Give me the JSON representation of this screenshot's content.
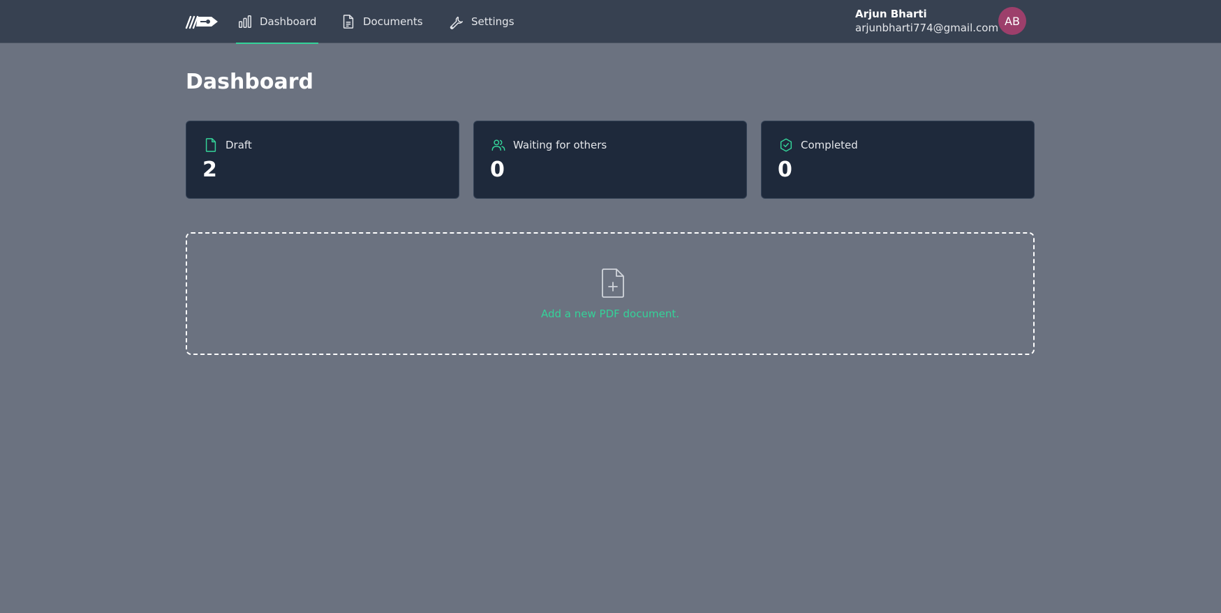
{
  "nav": {
    "items": [
      {
        "label": "Dashboard",
        "icon": "bar-chart-icon",
        "active": true
      },
      {
        "label": "Documents",
        "icon": "document-icon",
        "active": false
      },
      {
        "label": "Settings",
        "icon": "wrench-icon",
        "active": false
      }
    ]
  },
  "user": {
    "name": "Arjun Bharti",
    "email": "arjunbharti774@gmail.com",
    "initials": "AB",
    "avatar_color": "#9d3f6b"
  },
  "page": {
    "title": "Dashboard"
  },
  "stats": [
    {
      "label": "Draft",
      "value": "2",
      "icon": "file-icon"
    },
    {
      "label": "Waiting for others",
      "value": "0",
      "icon": "users-icon"
    },
    {
      "label": "Completed",
      "value": "0",
      "icon": "badge-check-icon"
    }
  ],
  "upload": {
    "text": "Add a new PDF document.",
    "icon": "file-plus-icon"
  },
  "colors": {
    "accent": "#34d399",
    "topbar": "#374151",
    "background": "#6b7280",
    "card": "#1e293b"
  }
}
